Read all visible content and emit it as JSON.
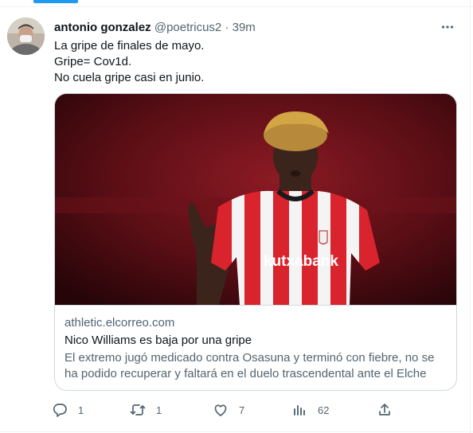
{
  "tweet": {
    "author_name": "antonio gonzalez",
    "handle": "@poetricus2",
    "separator": "·",
    "time": "39m",
    "text_lines": [
      "La gripe de finales de mayo.",
      "Gripe= Cov1d.",
      "No cuela gripe casi en junio."
    ]
  },
  "card": {
    "domain": "athletic.elcorreo.com",
    "title": "Nico Williams es baja por una gripe",
    "description": "El extremo jugó medicado contra Osasuna y terminó con fiebre, no se ha podido recuperar y faltará en el duelo trascendental ante el Elche",
    "image_sponsor_text": "kutxabank"
  },
  "actions": {
    "reply_count": "1",
    "retweet_count": "1",
    "like_count": "7",
    "views_count": "62"
  },
  "icons": {
    "more": "more-dots-icon",
    "reply": "reply-icon",
    "retweet": "retweet-icon",
    "like": "heart-icon",
    "views": "analytics-icon",
    "share": "share-icon"
  },
  "colors": {
    "accent": "#1d9bf0",
    "text_primary": "#0f1419",
    "text_secondary": "#536471",
    "border": "#cfd9de"
  }
}
